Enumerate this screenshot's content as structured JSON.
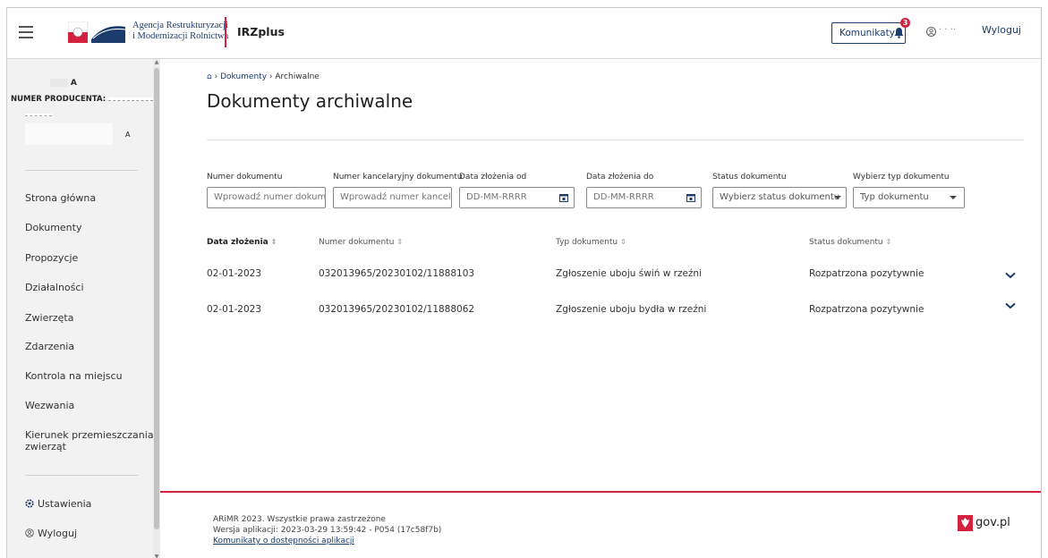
{
  "header": {
    "agency_line1": "Agencja Restrukturyzacji",
    "agency_line2": "i Modernizacji Rolnictwa",
    "app_name": "IRZplus",
    "komunikaty_label": "Komunikaty",
    "badge_count": "3",
    "user_name": "·  ·  ··",
    "logout_label": "Wyloguj"
  },
  "sidebar": {
    "user_letter": "A",
    "producer_label": "NUMER PRODUCENTA:",
    "producer_letter": "A",
    "nav_items": [
      "Strona główna",
      "Dokumenty",
      "Propozycje",
      "Działalności",
      "Zwierzęta",
      "Zdarzenia",
      "Kontrola na miejscu",
      "Wezwania",
      "Kierunek przemieszczania",
      "zwierząt"
    ],
    "settings_label": "Ustawienia",
    "logout_label": "Wyloguj"
  },
  "breadcrumb": {
    "home": "⌂",
    "sep": "›",
    "item1": "Dokumenty",
    "item2": "Archiwalne"
  },
  "page_title": "Dokumenty archiwalne",
  "filters": {
    "doc_number": {
      "label": "Numer dokumentu",
      "placeholder": "Wprowadź numer dokum"
    },
    "chancery_number": {
      "label": "Numer kancelaryjny dokumentu",
      "placeholder": "Wprowadź numer kancela"
    },
    "date_from": {
      "label": "Data złożenia od",
      "placeholder": "DD-MM-RRRR"
    },
    "date_to": {
      "label": "Data złożenia do",
      "placeholder": "DD-MM-RRRR"
    },
    "status": {
      "label": "Status dokumentu",
      "value": "Wybierz status dokumentu"
    },
    "type": {
      "label": "Wybierz typ dokumentu",
      "value": "Typ dokumentu"
    }
  },
  "table": {
    "headers": [
      "Data złożenia",
      "Numer dokumentu",
      "Typ dokumentu",
      "Status dokumentu"
    ],
    "rows": [
      {
        "date": "02-01-2023",
        "number": "032013965/20230102/11888103",
        "type": "Zgłoszenie uboju świń w rzeźni",
        "status": "Rozpatrzona pozytywnie"
      },
      {
        "date": "02-01-2023",
        "number": "032013965/20230102/11888062",
        "type": "Zgłoszenie uboju bydła w rzeźni",
        "status": "Rozpatrzona pozytywnie"
      }
    ]
  },
  "footer": {
    "copyright": "ARiMR 2023. Wszystkie prawa zastrzeżone",
    "version": "Wersja aplikacji: 2023-03-29 13:59:42 - P054 (17c58f7b)",
    "accessibility_link": "Komunikaty o dostępności aplikacji",
    "gov_label": "gov.pl"
  },
  "colors": {
    "brand_navy": "#1c3c6e",
    "accent_red": "#d4213d",
    "sidebar_bg": "#f2f2f2"
  }
}
